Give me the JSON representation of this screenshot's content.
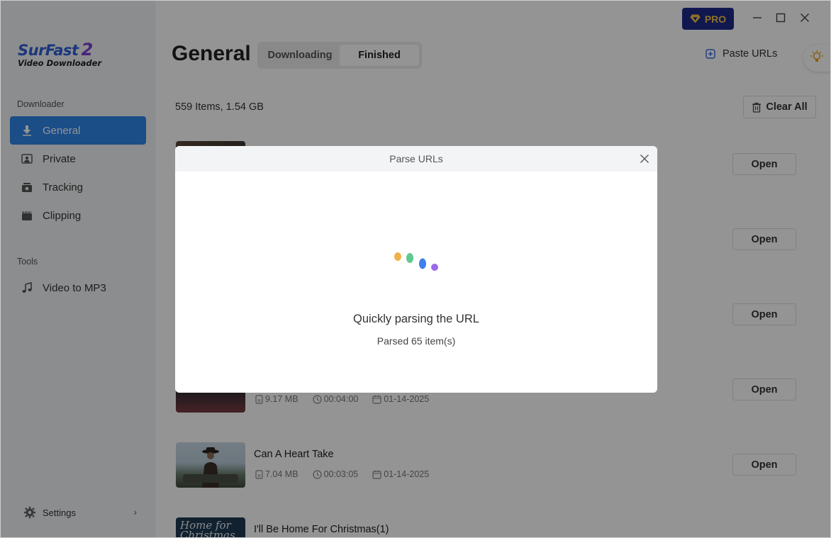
{
  "app": {
    "logo_name": "SurFast",
    "logo_version": "2",
    "logo_sub": "Video Downloader"
  },
  "window": {
    "pro_label": "PRO",
    "brand_color": "#1e2a8a",
    "accent_color": "#2f86e8"
  },
  "sidebar": {
    "downloader_label": "Downloader",
    "items": [
      {
        "label": "General",
        "icon": "download-icon",
        "active": true
      },
      {
        "label": "Private",
        "icon": "private-icon"
      },
      {
        "label": "Tracking",
        "icon": "tracking-icon"
      },
      {
        "label": "Clipping",
        "icon": "clipping-icon"
      }
    ],
    "tools_label": "Tools",
    "tools": [
      {
        "label": "Video to MP3",
        "icon": "music-note-icon"
      }
    ],
    "settings_label": "Settings"
  },
  "header": {
    "title": "General",
    "tabs": [
      {
        "label": "Downloading"
      },
      {
        "label": "Finished",
        "active": true
      }
    ],
    "paste_label": "Paste URLs"
  },
  "summary": {
    "count": "559 Items, 1.54 GB",
    "clear_label": "Clear All"
  },
  "items": [
    {
      "title": "",
      "size": "",
      "duration": "",
      "date": "",
      "open_label": "Open"
    },
    {
      "title": "",
      "size": "",
      "duration": "",
      "date": "",
      "open_label": "Open"
    },
    {
      "title": "",
      "size": "",
      "duration": "",
      "date": "",
      "open_label": "Open"
    },
    {
      "title": "",
      "size": "9.17 MB",
      "duration": "00:04:00",
      "date": "01-14-2025",
      "open_label": "Open"
    },
    {
      "title": "Can A Heart Take",
      "size": "7.04 MB",
      "duration": "00:03:05",
      "date": "01-14-2025",
      "open_label": "Open"
    },
    {
      "title": "I'll Be Home For Christmas(1)",
      "thumb_text": "Home for Christmas"
    }
  ],
  "dialog": {
    "title": "Parse URLs",
    "message": "Quickly parsing the URL",
    "progress": "Parsed 65 item(s)"
  }
}
